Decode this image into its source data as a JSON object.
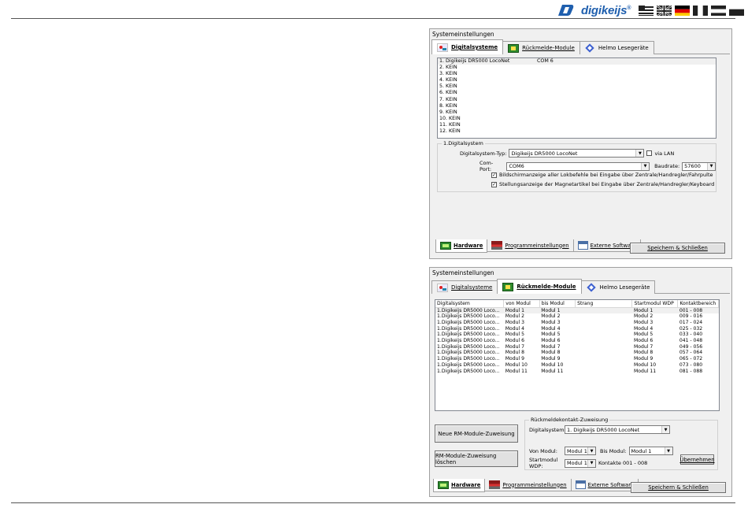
{
  "header": {
    "logo_text": "digikeijs",
    "logo_mark": "®",
    "flags": [
      "en-flag-icon",
      "uk-flag-icon",
      "de-flag-icon",
      "fr-flag-icon",
      "nl-flag-icon",
      "ee-flag-icon"
    ]
  },
  "win1": {
    "title": "Systemeinstellungen",
    "tabs": [
      "Digitalsysteme",
      "Rückmelde-Module",
      "Helmo Lesegeräte"
    ],
    "active_tab": 0,
    "list": [
      {
        "name": "1. Digikeijs DR5000 LocoNet",
        "port": "COM 6"
      },
      {
        "name": "2. KEIN",
        "port": ""
      },
      {
        "name": "3. KEIN",
        "port": ""
      },
      {
        "name": "4. KEIN",
        "port": ""
      },
      {
        "name": "5. KEIN",
        "port": ""
      },
      {
        "name": "6. KEIN",
        "port": ""
      },
      {
        "name": "7. KEIN",
        "port": ""
      },
      {
        "name": "8. KEIN",
        "port": ""
      },
      {
        "name": "9. KEIN",
        "port": ""
      },
      {
        "name": "10. KEIN",
        "port": ""
      },
      {
        "name": "11. KEIN",
        "port": ""
      },
      {
        "name": "12. KEIN",
        "port": ""
      }
    ],
    "group_label": "1.Digitalsystem",
    "type_label": "Digitalsystem-Typ:",
    "type_value": "Digikeijs DR5000 LocoNet",
    "lan_label": "via LAN",
    "port_label": "Com-Port:",
    "port_value": "COM6",
    "baud_label": "Baudrate:",
    "baud_value": "57600",
    "check1": "Bildschirmanzeige aller Lokbefehle bei Eingabe über Zentrale/Handregler/Fahrpulte",
    "check2": "Stellungsanzeige der Magnetartikel bei Eingabe über Zentrale/Handregler/Keyboard",
    "bottom_tabs": [
      "Hardware",
      "Programmeinstellungen",
      "Externe Software"
    ],
    "save_label": "Speichern & Schließen"
  },
  "win2": {
    "title": "Systemeinstellungen",
    "tabs": [
      "Digitalsysteme",
      "Rückmelde-Module",
      "Helmo Lesegeräte"
    ],
    "active_tab": 1,
    "columns": [
      "Digitalsystem",
      "von Modul",
      "bis Modul",
      "Strang",
      "Startmodul WDP",
      "Kontaktbereich"
    ],
    "rows": [
      [
        "1.Digikeijs DR5000 Loco...",
        "Modul 1",
        "Modul 1",
        "",
        "Modul 1",
        "001 - 008"
      ],
      [
        "1.Digikeijs DR5000 Loco...",
        "Modul 2",
        "Modul 2",
        "",
        "Modul 2",
        "009 - 016"
      ],
      [
        "1.Digikeijs DR5000 Loco...",
        "Modul 3",
        "Modul 3",
        "",
        "Modul 3",
        "017 - 024"
      ],
      [
        "1.Digikeijs DR5000 Loco...",
        "Modul 4",
        "Modul 4",
        "",
        "Modul 4",
        "025 - 032"
      ],
      [
        "1.Digikeijs DR5000 Loco...",
        "Modul 5",
        "Modul 5",
        "",
        "Modul 5",
        "033 - 040"
      ],
      [
        "1.Digikeijs DR5000 Loco...",
        "Modul 6",
        "Modul 6",
        "",
        "Modul 6",
        "041 - 048"
      ],
      [
        "1.Digikeijs DR5000 Loco...",
        "Modul 7",
        "Modul 7",
        "",
        "Modul 7",
        "049 - 056"
      ],
      [
        "1.Digikeijs DR5000 Loco...",
        "Modul 8",
        "Modul 8",
        "",
        "Modul 8",
        "057 - 064"
      ],
      [
        "1.Digikeijs DR5000 Loco...",
        "Modul 9",
        "Modul 9",
        "",
        "Modul 9",
        "065 - 072"
      ],
      [
        "1.Digikeijs DR5000 Loco...",
        "Modul 10",
        "Modul 10",
        "",
        "Modul 10",
        "073 - 080"
      ],
      [
        "1.Digikeijs DR5000 Loco...",
        "Modul 11",
        "Modul 11",
        "",
        "Modul 11",
        "081 - 088"
      ]
    ],
    "new_btn": "Neue RM-Module-Zuweisung",
    "del_btn": "RM-Module-Zuweisung löschen",
    "group_label": "Rückmeldekontakt-Zuweisung",
    "ds_label": "Digitalsystem:",
    "ds_value": "1. Digikeijs DR5000 LocoNet",
    "von_label": "Von Modul:",
    "von_value": "Modul 1",
    "bis_label": "Bis Modul:",
    "bis_value": "Modul 1",
    "wdp_label": "Startmodul WDP:",
    "wdp_value": "Modul 1",
    "kontakte": "Kontakte 001 - 008",
    "apply_label": "Übernehmen",
    "bottom_tabs": [
      "Hardware",
      "Programmeinstellungen",
      "Externe Software"
    ],
    "save_label": "Speichern & Schließen"
  }
}
